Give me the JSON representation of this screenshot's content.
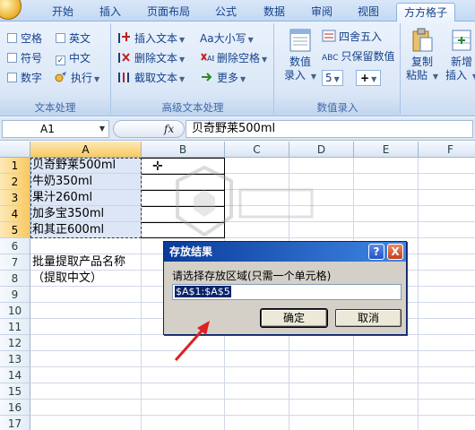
{
  "tabs": [
    "开始",
    "插入",
    "页面布局",
    "公式",
    "数据",
    "审阅",
    "视图",
    "方方格子"
  ],
  "active_tab": "方方格子",
  "ribbon": {
    "text_group": {
      "label": "文本处理",
      "checkboxes": [
        {
          "label": "空格",
          "checked": false
        },
        {
          "label": "英文",
          "checked": false
        },
        {
          "label": "符号",
          "checked": false
        },
        {
          "label": "中文",
          "checked": true
        },
        {
          "label": "数字",
          "checked": false
        }
      ],
      "exec_label": "执行"
    },
    "adv_group": {
      "label": "高级文本处理",
      "buttons": [
        "插入文本",
        "删除文本",
        "截取文本",
        "Aa大小写",
        "删除空格",
        "更多"
      ]
    },
    "entry_group": {
      "label": "数值录入",
      "big_button": "数值\n录入",
      "round_label": "四舍五入",
      "keep_label": "只保留数值",
      "small_value": "5"
    },
    "paste_group": {
      "copy_paste": "复制\n粘贴",
      "add_insert": "新增\n插入"
    }
  },
  "formula_bar": {
    "cell_ref": "A1",
    "fx": "fx",
    "content": "贝奇野莱500ml"
  },
  "grid": {
    "columns": [
      "A",
      "B",
      "C",
      "D",
      "E",
      "F"
    ],
    "rows": [
      "1",
      "2",
      "3",
      "4",
      "5",
      "6",
      "7",
      "8",
      "9",
      "10",
      "11",
      "12",
      "13",
      "14",
      "15",
      "16",
      "17"
    ],
    "cells": {
      "A1": "贝奇野莱500ml",
      "A2": "牛奶350ml",
      "A3": "果汁260ml",
      "A4": "加多宝350ml",
      "A5": "和其正600ml",
      "A7": "批量提取产品名称",
      "A8": "（提取中文）"
    }
  },
  "dialog": {
    "title": "存放结果",
    "help": "?",
    "close": "X",
    "prompt": "请选择存放区域(只需一个单元格)",
    "input_value": "$A$1:$A$5",
    "ok_label": "确定",
    "cancel_label": "取消"
  },
  "colors": {
    "ribbon_text": "#15428b",
    "dialog_title_start": "#0a3b9a",
    "annotation_arrow": "#e02020"
  }
}
